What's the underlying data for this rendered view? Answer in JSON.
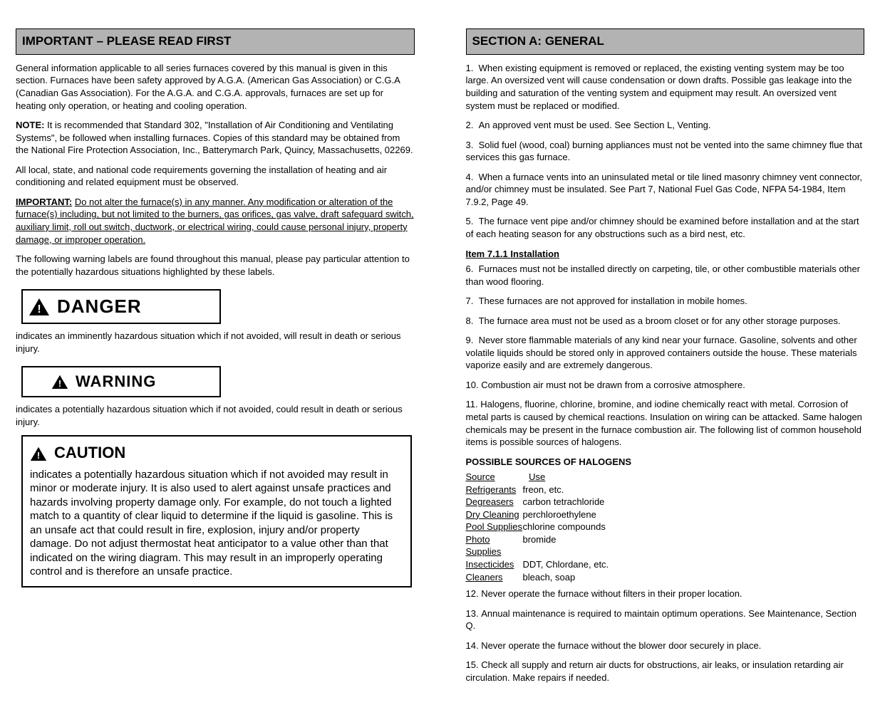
{
  "left": {
    "header": "IMPORTANT – PLEASE READ FIRST",
    "p1_intro": "General information applicable to all series furnaces covered by this manual is given in this section. Furnaces have been safety approved by A.G.A. (American Gas Association) or C.G.A (Canadian Gas Association). For the A.G.A. and C.G.A. approvals, furnaces are set up for heating only operation, or heating and cooling operation.",
    "note_label": "NOTE:",
    "p2_note": "It is recommended that Standard 302, \"Installation of Air Conditioning and Ventilating Systems\", be followed when installing furnaces. Copies of this standard may be obtained from the National Fire Protection Association, Inc., Batterymarch Park, Quincy, Massachusetts, 02269.",
    "p3_regs": "All local, state, and national code requirements governing the installation of heating and air conditioning and related equipment must be observed.",
    "important_label": "IMPORTANT:",
    "p4_imp": "Do not alter the furnace(s) in any manner. Any modification or alteration of the furnace(s) including, but not limited to the burners, gas orifices, gas valve, draft safeguard switch, auxiliary limit, roll out switch, ductwork, or electrical wiring, could cause personal injury, property damage, or improper operation.",
    "labels_intro": "The following warning labels are found throughout this manual, please pay particular attention to the potentially hazardous situations highlighted by these labels.",
    "danger_label": "DANGER",
    "danger_desc": "indicates an imminently hazardous situation which if not avoided, will result in death or serious injury.",
    "warning_label": "WARNING",
    "warning_desc": "indicates a potentially hazardous situation which if not avoided, could result in death or serious injury.",
    "caution_label": "CAUTION",
    "caution_body": "indicates a potentially hazardous situation which if not avoided may result in minor or moderate injury. It is also used to alert against unsafe practices and hazards involving property damage only. For example, do not touch a lighted match to a quantity of clear liquid to determine if the liquid is gasoline. This is an unsafe act that could result in fire, explosion, injury and/or property damage. Do not adjust thermostat heat anticipator to a value other than that indicated on the wiring diagram. This may result in an improperly operating control and is therefore an unsafe practice."
  },
  "right": {
    "header": "SECTION A: GENERAL",
    "items": [
      "When existing equipment is removed or replaced, the existing venting system may be too large. An oversized vent will cause condensation or down drafts. Possible gas leakage into the building and saturation of the venting system and equipment may result. An oversized vent system must be replaced or modified.",
      "An approved vent must be used. See Section L, Venting.",
      "Solid fuel (wood, coal) burning appliances must not be vented into the same chimney flue that services this gas furnace.",
      "When a furnace vents into an uninsulated metal or tile lined masonry chimney vent connector, and/or chimney must be insulated. See Part 7, National Fuel Gas Code, NFPA 54-1984, Item 7.9.2, Page 49.",
      "The furnace vent pipe and/or chimney should be examined before installation and at the start of each heating season for any obstructions such as a bird nest, etc.",
      "Furnaces must not be installed directly on carpeting, tile, or other combustible materials other than wood flooring.",
      "These furnaces are not approved for installation in mobile homes.",
      "The furnace area must not be used as a broom closet or for any other storage purposes.",
      "Never store flammable materials of any kind near your furnace. Gasoline, solvents and other volatile liquids should be stored only in approved containers outside the house. These materials vaporize easily and are extremely dangerous.",
      "Combustion air must not be drawn from a corrosive atmosphere.",
      "Halogens, fluorine, chlorine, bromine, and iodine chemically react with metal. Corrosion of metal parts is caused by chemical reactions. Insulation on wiring can be attacked. Same halogen chemicals may be present in the furnace combustion air. The following list of common household items is possible sources of halogens.",
      "Never operate the furnace without filters in their proper location.",
      "Annual maintenance is required to maintain optimum operations. See Maintenance, Section Q.",
      "Never operate the furnace without the blower door securely in place.",
      "Check all supply and return air ducts for obstructions, air leaks, or insulation retarding air circulation. Make repairs if needed."
    ],
    "sources_head": "POSSIBLE SOURCES OF HALOGENS",
    "sources": [
      [
        "Refrigerants",
        "freon, etc."
      ],
      [
        "Degreasers",
        "carbon tetrachloride"
      ],
      [
        "Dry Cleaning",
        "perchloroethylene"
      ],
      [
        "Pool Supplies",
        "chlorine compounds"
      ],
      [
        "Photo Supplies",
        "bromide"
      ],
      [
        "Insecticides",
        "DDT, Chlordane, etc."
      ],
      [
        "Cleaners",
        "bleach, soap"
      ]
    ]
  }
}
